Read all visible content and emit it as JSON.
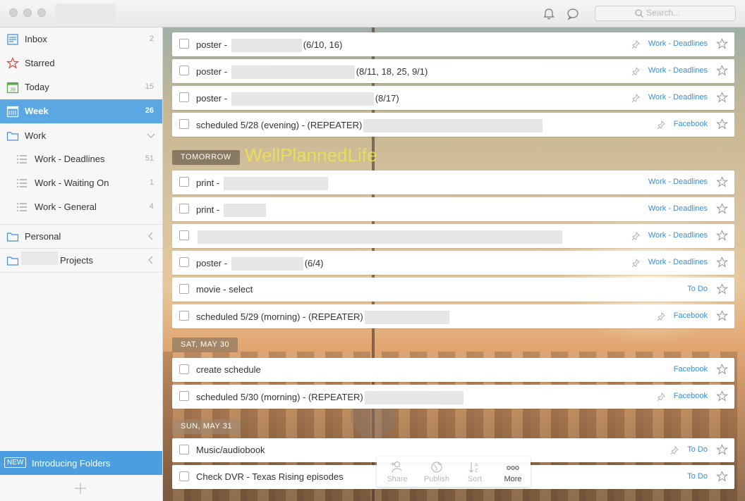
{
  "titlebar": {
    "search_placeholder": "Search..."
  },
  "sidebar": {
    "items": [
      {
        "label": "Inbox",
        "count": "2",
        "icon": "inbox-icon"
      },
      {
        "label": "Starred",
        "count": "",
        "icon": "star-icon"
      },
      {
        "label": "Today",
        "count": "15",
        "icon": "calendar-today-icon",
        "day": "28"
      },
      {
        "label": "Week",
        "count": "26",
        "icon": "week-calendar-icon"
      },
      {
        "label": "Work",
        "count": "",
        "icon": "folder-icon"
      },
      {
        "label": "Work - Deadlines",
        "count": "51",
        "icon": "list-icon"
      },
      {
        "label": "Work - Waiting On",
        "count": "1",
        "icon": "list-icon"
      },
      {
        "label": "Work - General",
        "count": "4",
        "icon": "list-icon"
      },
      {
        "label": "Personal",
        "count": "",
        "icon": "folder-icon"
      },
      {
        "label": "Projects",
        "count": "",
        "icon": "folder-icon"
      }
    ],
    "intro_badge": "NEW",
    "intro_text": "Introducing Folders"
  },
  "watermark": "WellPlannedLife",
  "sections": {
    "tomorrow": "TOMORROW",
    "sat": "SAT, MAY 30",
    "sun": "SUN, MAY 31"
  },
  "tasks": [
    {
      "title": "poster - ",
      "suffix": "(6/10, 16)",
      "list": "Work - Deadlines"
    },
    {
      "title": "poster - ",
      "suffix": "(8/11, 18, 25, 9/1)",
      "list": "Work - Deadlines"
    },
    {
      "title": "poster - ",
      "suffix": "(8/17)",
      "list": "Work - Deadlines"
    },
    {
      "title": "scheduled 5/28 (evening) - (REPEATER)",
      "suffix": "",
      "list": "Facebook"
    },
    {
      "title": "print - ",
      "suffix": "",
      "list": "Work - Deadlines"
    },
    {
      "title": "print - ",
      "suffix": "",
      "list": "Work - Deadlines"
    },
    {
      "title": "",
      "suffix": "",
      "list": "Work - Deadlines"
    },
    {
      "title": "poster - ",
      "suffix": "(6/4)",
      "list": "Work - Deadlines"
    },
    {
      "title": "movie - select",
      "suffix": "",
      "list": "To Do"
    },
    {
      "title": "scheduled 5/29 (morning) - (REPEATER)",
      "suffix": "",
      "list": "Facebook"
    },
    {
      "title": "create schedule",
      "suffix": "",
      "list": "Facebook"
    },
    {
      "title": "scheduled 5/30 (morning) - (REPEATER)",
      "suffix": "",
      "list": "Facebook"
    },
    {
      "title": "Music/audiobook",
      "suffix": "",
      "list": "To Do"
    },
    {
      "title": "Check DVR - Texas Rising episodes",
      "suffix": "",
      "list": "To Do"
    }
  ],
  "toolbar": {
    "share": "Share",
    "publish": "Publish",
    "sort": "Sort",
    "more": "More"
  }
}
